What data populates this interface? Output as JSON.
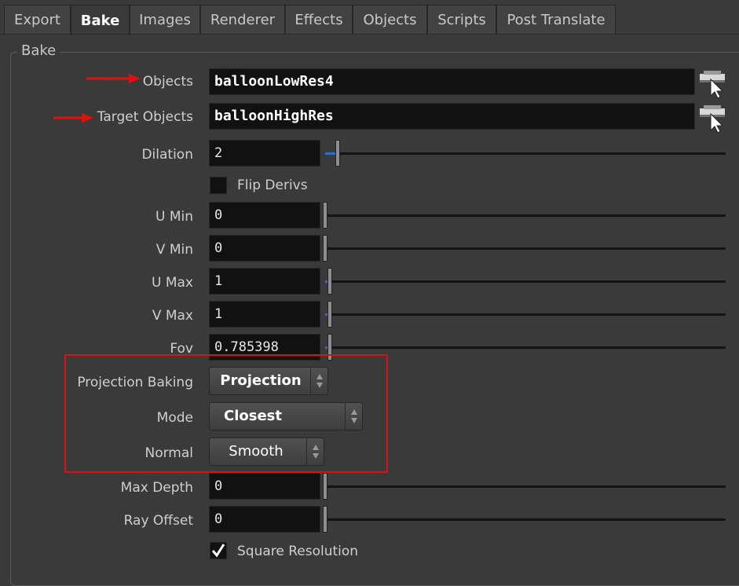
{
  "tabs": [
    {
      "label": "Export"
    },
    {
      "label": "Bake"
    },
    {
      "label": "Images"
    },
    {
      "label": "Renderer"
    },
    {
      "label": "Effects"
    },
    {
      "label": "Objects"
    },
    {
      "label": "Scripts"
    },
    {
      "label": "Post Translate"
    }
  ],
  "active_tab": "Bake",
  "group_title": "Bake",
  "objects": {
    "label": "Objects",
    "value": "balloonLowRes4"
  },
  "target_objects": {
    "label": "Target Objects",
    "value": "balloonHighRes"
  },
  "dilation": {
    "label": "Dilation",
    "value": "2"
  },
  "flip_derivs": {
    "label": "Flip Derivs",
    "checked": false
  },
  "u_min": {
    "label": "U Min",
    "value": "0"
  },
  "v_min": {
    "label": "V Min",
    "value": "0"
  },
  "u_max": {
    "label": "U Max",
    "value": "1"
  },
  "v_max": {
    "label": "V Max",
    "value": "1"
  },
  "fov": {
    "label": "Fov",
    "value": "0.785398"
  },
  "projection_baking": {
    "label": "Projection Baking",
    "value": "Projection"
  },
  "mode": {
    "label": "Mode",
    "value": "Closest"
  },
  "normal": {
    "label": "Normal",
    "value": "Smooth"
  },
  "max_depth": {
    "label": "Max Depth",
    "value": "0"
  },
  "ray_offset": {
    "label": "Ray Offset",
    "value": "0"
  },
  "square_resolution": {
    "label": "Square Resolution",
    "checked": true
  },
  "colors": {
    "annotation": "#e01010",
    "field_bg": "#111111",
    "panel_bg": "#3a3a3a"
  }
}
